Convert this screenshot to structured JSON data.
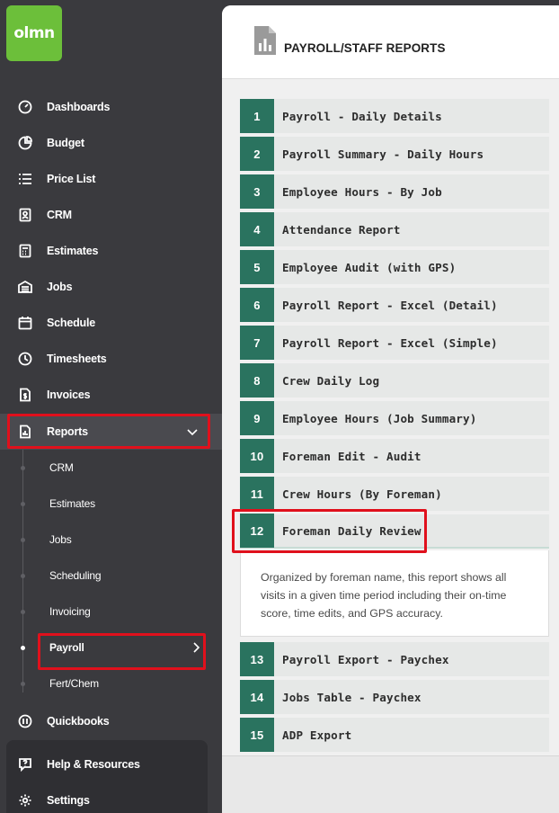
{
  "logo": {
    "text": "olmn"
  },
  "sidebar": {
    "items": [
      {
        "label": "Dashboards",
        "icon": "dashboard-gauge-icon"
      },
      {
        "label": "Budget",
        "icon": "pie-chart-icon"
      },
      {
        "label": "Price List",
        "icon": "list-icon"
      },
      {
        "label": "CRM",
        "icon": "contact-card-icon"
      },
      {
        "label": "Estimates",
        "icon": "calculator-icon"
      },
      {
        "label": "Jobs",
        "icon": "garage-icon"
      },
      {
        "label": "Schedule",
        "icon": "calendar-icon"
      },
      {
        "label": "Timesheets",
        "icon": "clock-icon"
      },
      {
        "label": "Invoices",
        "icon": "invoice-dollar-icon"
      },
      {
        "label": "Reports",
        "icon": "report-chart-icon"
      }
    ],
    "report_subitems": [
      {
        "label": "CRM"
      },
      {
        "label": "Estimates"
      },
      {
        "label": "Jobs"
      },
      {
        "label": "Scheduling"
      },
      {
        "label": "Invoicing"
      },
      {
        "label": "Payroll"
      },
      {
        "label": "Fert/Chem"
      }
    ],
    "quickbooks": {
      "label": "Quickbooks",
      "icon": "quickbooks-icon"
    },
    "help": {
      "label": "Help & Resources",
      "icon": "help-chat-icon"
    },
    "settings": {
      "label": "Settings",
      "icon": "gear-icon"
    }
  },
  "header": {
    "title": "PAYROLL/STAFF REPORTS",
    "icon": "document-chart-icon"
  },
  "reports": [
    {
      "num": "1",
      "name": "Payroll - Daily Details"
    },
    {
      "num": "2",
      "name": "Payroll Summary - Daily Hours"
    },
    {
      "num": "3",
      "name": "Employee Hours - By Job"
    },
    {
      "num": "4",
      "name": "Attendance Report"
    },
    {
      "num": "5",
      "name": "Employee Audit (with GPS)"
    },
    {
      "num": "6",
      "name": "Payroll Report - Excel (Detail)"
    },
    {
      "num": "7",
      "name": "Payroll Report - Excel (Simple)"
    },
    {
      "num": "8",
      "name": "Crew Daily Log"
    },
    {
      "num": "9",
      "name": "Employee Hours (Job Summary)"
    },
    {
      "num": "10",
      "name": "Foreman Edit - Audit"
    },
    {
      "num": "11",
      "name": "Crew Hours (By Foreman)"
    },
    {
      "num": "12",
      "name": "Foreman Daily Review"
    },
    {
      "num": "13",
      "name": "Payroll Export - Paychex"
    },
    {
      "num": "14",
      "name": "Jobs Table - Paychex"
    },
    {
      "num": "15",
      "name": "ADP Export"
    }
  ],
  "expanded_description": "Organized by foreman name, this report shows all visits in a given time period including their on-time score, time edits, and GPS accuracy.",
  "colors": {
    "accent": "#2a735f",
    "brand": "#6cbf3a",
    "highlight": "#e0101c"
  }
}
